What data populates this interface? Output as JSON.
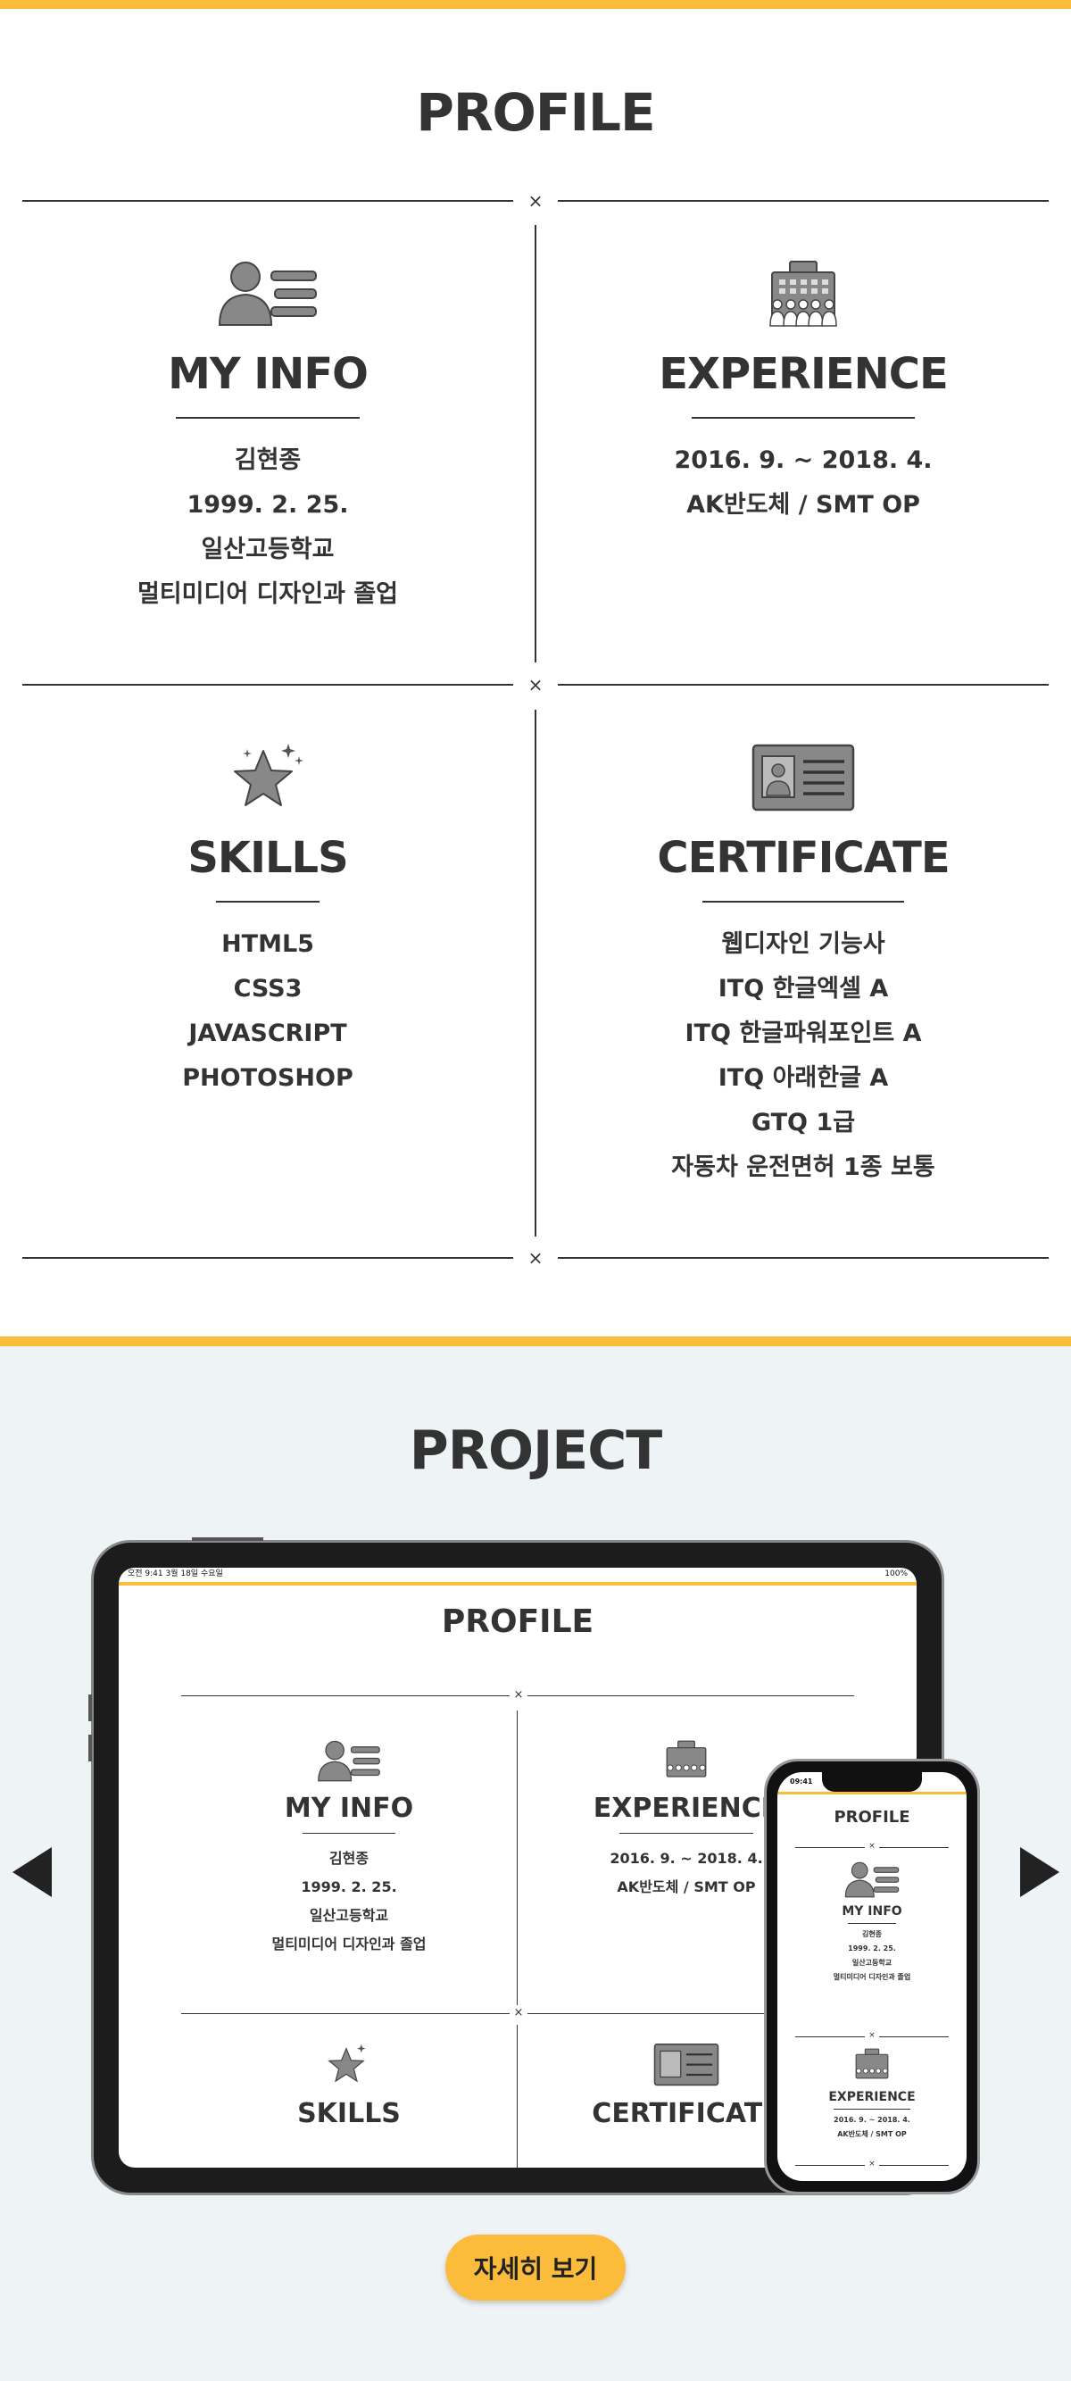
{
  "profile": {
    "title": "PROFILE",
    "separator": "×",
    "my_info": {
      "icon": "user-profile-icon",
      "title": "MY INFO",
      "lines": [
        "김현종",
        "1999. 2. 25.",
        "일산고등학교",
        "멀티미디어 디자인과 졸업"
      ]
    },
    "experience": {
      "icon": "building-people-icon",
      "title": "EXPERIENCE",
      "lines": [
        "2016. 9. ~ 2018. 4.",
        "AK반도체 / SMT OP"
      ]
    },
    "skills": {
      "icon": "star-icon",
      "title": "SKILLS",
      "lines": [
        "HTML5",
        "CSS3",
        "JAVASCRIPT",
        "PHOTOSHOP"
      ]
    },
    "certificate": {
      "icon": "id-card-icon",
      "title": "CERTIFICATE",
      "lines": [
        "웹디자인 기능사",
        "ITQ 한글엑셀 A",
        "ITQ 한글파워포인트 A",
        "ITQ 아래한글 A",
        "GTQ 1급",
        "자동차 운전면허 1종 보통"
      ]
    }
  },
  "project": {
    "title": "PROJECT",
    "tablet_status_left": "오전 9:41   3월 18일 수요일",
    "tablet_status_right": "100%",
    "phone_status_time": "09:41",
    "more_button": "자세히 보기",
    "prev_icon": "left-triangle-arrow-icon",
    "next_icon": "right-triangle-arrow-icon"
  },
  "colors": {
    "accent": "#fbbc3c",
    "text": "#333333",
    "project_bg": "#eef3f5"
  }
}
